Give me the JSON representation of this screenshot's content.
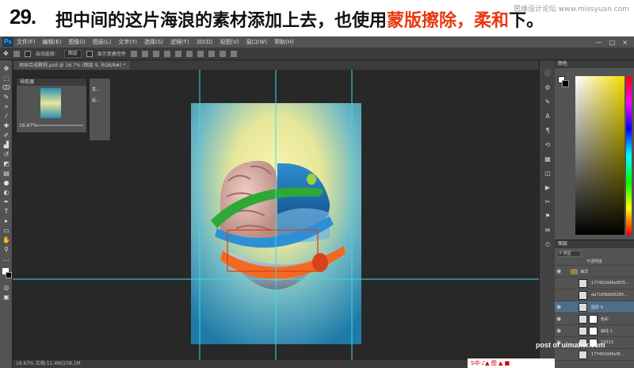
{
  "caption": {
    "number": "29.",
    "text_plain": "把中间的这片海浪的素材添加上去，也使用",
    "text_red_1": "蒙版擦除",
    "sep": "，",
    "text_red_2": "柔和",
    "text_end": "下。",
    "watermark": "思缘设计论坛 www.missyuan.com"
  },
  "menubar": {
    "logo": "Ps",
    "items": [
      "文件(F)",
      "编辑(E)",
      "图像(I)",
      "图层(L)",
      "文字(Y)",
      "选择(S)",
      "滤镜(T)",
      "3D(D)",
      "视图(V)",
      "窗口(W)",
      "帮助(H)"
    ],
    "window_buttons": [
      "—",
      "□",
      "×"
    ]
  },
  "optionsbar": {
    "auto_select_label": "自动选择：",
    "auto_select_value": "图层",
    "show_transform_label": "显示变换控件"
  },
  "document_tab": {
    "label": "地球合成教程.psd @ 16.7% (图层 9, RGB/8#) *"
  },
  "navigator": {
    "title": "导航器",
    "zoom": "16.67%"
  },
  "mini_panel": {
    "item1": "直...",
    "item2": "属..."
  },
  "color_panel": {
    "title": "颜色"
  },
  "layers_panel": {
    "title": "图层",
    "kind_label": "P 类型",
    "opacity_label": "不透明度",
    "rows": [
      {
        "name": "海洋",
        "type": "folder"
      },
      {
        "name": "177462b86e9f25...",
        "type": "layer"
      },
      {
        "name": "da7169b6d5285...",
        "type": "layer"
      },
      {
        "name": "图层 9",
        "type": "layer",
        "selected": true
      },
      {
        "name": "色彩",
        "type": "adjust"
      },
      {
        "name": "曲线 1",
        "type": "adjust"
      },
      {
        "name": "13313",
        "type": "mask"
      },
      {
        "name": "177462b86e9f...",
        "type": "layer"
      }
    ]
  },
  "statusbar": {
    "text": "16.67%    文档:11.4M/238.1M"
  },
  "watermark_bottom": "post of uimaker.com",
  "toast": "S中·♪▲ 图 ▲ ■"
}
